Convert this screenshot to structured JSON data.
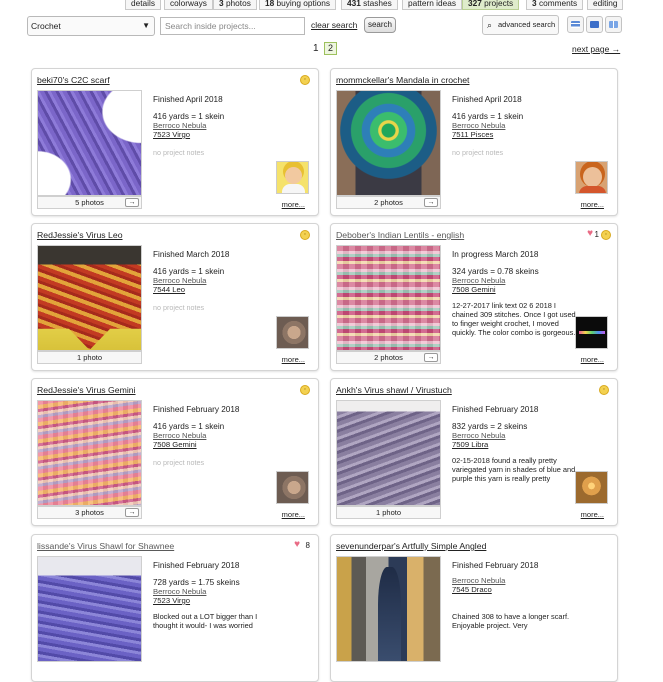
{
  "tabs": [
    {
      "count": "",
      "label": "details"
    },
    {
      "count": "",
      "label": "colorways"
    },
    {
      "count": "3",
      "label": "photos"
    },
    {
      "count": "18",
      "label": "buying options"
    },
    {
      "count": "431",
      "label": "stashes"
    },
    {
      "count": "",
      "label": "pattern ideas"
    },
    {
      "count": "327",
      "label": "projects"
    },
    {
      "count": "3",
      "label": "comments"
    },
    {
      "count": "",
      "label": "editing"
    }
  ],
  "toolbar": {
    "craft_select": "Crochet",
    "search_placeholder": "Search inside projects...",
    "clear_search": "clear search",
    "search_button": "search",
    "advanced_search": "advanced search"
  },
  "pagination": {
    "current": "1",
    "page2": "2",
    "next": "next page →"
  },
  "cards": [
    {
      "title": "beki70's C2C scarf",
      "status": "Finished April 2018",
      "yardage": "416 yards = 1 skein",
      "yarn": "Berroco Nebula",
      "color": "7523 Virgo",
      "notes": "",
      "notes_empty": "no project notes",
      "photos": "5 photos",
      "more": "more...",
      "hearts": ""
    },
    {
      "title": "mommckellar's Mandala in crochet",
      "status": "Finished April 2018",
      "yardage": "416 yards = 1 skein",
      "yarn": "Berroco Nebula",
      "color": "7511 Pisces",
      "notes": "",
      "notes_empty": "no project notes",
      "photos": "2 photos",
      "more": "more...",
      "hearts": ""
    },
    {
      "title": "RedJessie's Virus Leo",
      "status": "Finished March 2018",
      "yardage": "416 yards = 1 skein",
      "yarn": "Berroco Nebula",
      "color": "7544 Leo",
      "notes": "",
      "notes_empty": "no project notes",
      "photos": "1 photo",
      "more": "more...",
      "hearts": ""
    },
    {
      "title": "Debober's Indian Lentils - english",
      "status": "In progress March 2018",
      "yardage": "324 yards = 0.78 skeins",
      "yarn": "Berroco Nebula",
      "color": "7508 Gemini",
      "notes": "12-27-2017 link text 02 6 2018 I chained 309 stitches. Once I got used to finger weight crochet, I moved quickly. The color combo is gorgeous.",
      "notes_empty": "",
      "photos": "2 photos",
      "more": "more...",
      "hearts": "1"
    },
    {
      "title": "RedJessie's Virus Gemini",
      "status": "Finished February 2018",
      "yardage": "416 yards = 1 skein",
      "yarn": "Berroco Nebula",
      "color": "7508 Gemini",
      "notes": "",
      "notes_empty": "no project notes",
      "photos": "3 photos",
      "more": "more...",
      "hearts": ""
    },
    {
      "title": "Ankh's Virus shawl / Virustuch",
      "status": "Finished February 2018",
      "yardage": "832 yards = 2 skeins",
      "yarn": "Berroco Nebula",
      "color": "7509 Libra",
      "notes": "02-15-2018 found a really pretty variegated yarn in shades of blue and purple this yarn is really pretty",
      "notes_empty": "",
      "photos": "1 photo",
      "more": "more...",
      "hearts": ""
    },
    {
      "title": "lissande's Virus Shawl for Shawnee",
      "status": "Finished February 2018",
      "yardage": "728 yards = 1.75 skeins",
      "yarn": "Berroco Nebula",
      "color": "7523 Virgo",
      "notes": "Blocked out a LOT bigger than I thought it would- I was worried",
      "notes_empty": "",
      "photos": "",
      "more": "",
      "hearts": "8"
    },
    {
      "title": "sevenunderpar's Artfully Simple Angled",
      "status": "Finished February 2018",
      "yardage": "",
      "yarn": "Berroco Nebula",
      "color": "7545 Draco",
      "notes": "Chained 308 to have a longer scarf. Enjoyable project. Very",
      "notes_empty": "",
      "photos": "",
      "more": "",
      "hearts": ""
    }
  ],
  "icons": {
    "smiley": "smiley-face-icon",
    "heart": "heart-icon",
    "arrow": "right-arrow-icon",
    "magnifier": "magnifier-icon"
  },
  "colors": {
    "active_tab": "#dfeccb",
    "heart": "#e96b85",
    "smiley": "#f3d150"
  }
}
